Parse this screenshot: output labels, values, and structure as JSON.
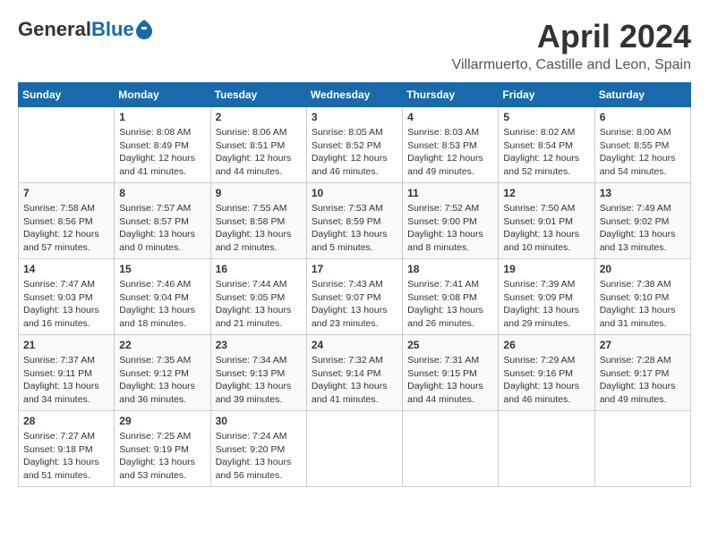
{
  "header": {
    "logo_general": "General",
    "logo_blue": "Blue",
    "month_title": "April 2024",
    "subtitle": "Villarmuerto, Castille and Leon, Spain"
  },
  "calendar": {
    "days_of_week": [
      "Sunday",
      "Monday",
      "Tuesday",
      "Wednesday",
      "Thursday",
      "Friday",
      "Saturday"
    ],
    "weeks": [
      [
        {
          "day": "",
          "info": ""
        },
        {
          "day": "1",
          "info": "Sunrise: 8:08 AM\nSunset: 8:49 PM\nDaylight: 12 hours\nand 41 minutes."
        },
        {
          "day": "2",
          "info": "Sunrise: 8:06 AM\nSunset: 8:51 PM\nDaylight: 12 hours\nand 44 minutes."
        },
        {
          "day": "3",
          "info": "Sunrise: 8:05 AM\nSunset: 8:52 PM\nDaylight: 12 hours\nand 46 minutes."
        },
        {
          "day": "4",
          "info": "Sunrise: 8:03 AM\nSunset: 8:53 PM\nDaylight: 12 hours\nand 49 minutes."
        },
        {
          "day": "5",
          "info": "Sunrise: 8:02 AM\nSunset: 8:54 PM\nDaylight: 12 hours\nand 52 minutes."
        },
        {
          "day": "6",
          "info": "Sunrise: 8:00 AM\nSunset: 8:55 PM\nDaylight: 12 hours\nand 54 minutes."
        }
      ],
      [
        {
          "day": "7",
          "info": "Sunrise: 7:58 AM\nSunset: 8:56 PM\nDaylight: 12 hours\nand 57 minutes."
        },
        {
          "day": "8",
          "info": "Sunrise: 7:57 AM\nSunset: 8:57 PM\nDaylight: 13 hours\nand 0 minutes."
        },
        {
          "day": "9",
          "info": "Sunrise: 7:55 AM\nSunset: 8:58 PM\nDaylight: 13 hours\nand 2 minutes."
        },
        {
          "day": "10",
          "info": "Sunrise: 7:53 AM\nSunset: 8:59 PM\nDaylight: 13 hours\nand 5 minutes."
        },
        {
          "day": "11",
          "info": "Sunrise: 7:52 AM\nSunset: 9:00 PM\nDaylight: 13 hours\nand 8 minutes."
        },
        {
          "day": "12",
          "info": "Sunrise: 7:50 AM\nSunset: 9:01 PM\nDaylight: 13 hours\nand 10 minutes."
        },
        {
          "day": "13",
          "info": "Sunrise: 7:49 AM\nSunset: 9:02 PM\nDaylight: 13 hours\nand 13 minutes."
        }
      ],
      [
        {
          "day": "14",
          "info": "Sunrise: 7:47 AM\nSunset: 9:03 PM\nDaylight: 13 hours\nand 16 minutes."
        },
        {
          "day": "15",
          "info": "Sunrise: 7:46 AM\nSunset: 9:04 PM\nDaylight: 13 hours\nand 18 minutes."
        },
        {
          "day": "16",
          "info": "Sunrise: 7:44 AM\nSunset: 9:05 PM\nDaylight: 13 hours\nand 21 minutes."
        },
        {
          "day": "17",
          "info": "Sunrise: 7:43 AM\nSunset: 9:07 PM\nDaylight: 13 hours\nand 23 minutes."
        },
        {
          "day": "18",
          "info": "Sunrise: 7:41 AM\nSunset: 9:08 PM\nDaylight: 13 hours\nand 26 minutes."
        },
        {
          "day": "19",
          "info": "Sunrise: 7:39 AM\nSunset: 9:09 PM\nDaylight: 13 hours\nand 29 minutes."
        },
        {
          "day": "20",
          "info": "Sunrise: 7:38 AM\nSunset: 9:10 PM\nDaylight: 13 hours\nand 31 minutes."
        }
      ],
      [
        {
          "day": "21",
          "info": "Sunrise: 7:37 AM\nSunset: 9:11 PM\nDaylight: 13 hours\nand 34 minutes."
        },
        {
          "day": "22",
          "info": "Sunrise: 7:35 AM\nSunset: 9:12 PM\nDaylight: 13 hours\nand 36 minutes."
        },
        {
          "day": "23",
          "info": "Sunrise: 7:34 AM\nSunset: 9:13 PM\nDaylight: 13 hours\nand 39 minutes."
        },
        {
          "day": "24",
          "info": "Sunrise: 7:32 AM\nSunset: 9:14 PM\nDaylight: 13 hours\nand 41 minutes."
        },
        {
          "day": "25",
          "info": "Sunrise: 7:31 AM\nSunset: 9:15 PM\nDaylight: 13 hours\nand 44 minutes."
        },
        {
          "day": "26",
          "info": "Sunrise: 7:29 AM\nSunset: 9:16 PM\nDaylight: 13 hours\nand 46 minutes."
        },
        {
          "day": "27",
          "info": "Sunrise: 7:28 AM\nSunset: 9:17 PM\nDaylight: 13 hours\nand 49 minutes."
        }
      ],
      [
        {
          "day": "28",
          "info": "Sunrise: 7:27 AM\nSunset: 9:18 PM\nDaylight: 13 hours\nand 51 minutes."
        },
        {
          "day": "29",
          "info": "Sunrise: 7:25 AM\nSunset: 9:19 PM\nDaylight: 13 hours\nand 53 minutes."
        },
        {
          "day": "30",
          "info": "Sunrise: 7:24 AM\nSunset: 9:20 PM\nDaylight: 13 hours\nand 56 minutes."
        },
        {
          "day": "",
          "info": ""
        },
        {
          "day": "",
          "info": ""
        },
        {
          "day": "",
          "info": ""
        },
        {
          "day": "",
          "info": ""
        }
      ]
    ]
  }
}
